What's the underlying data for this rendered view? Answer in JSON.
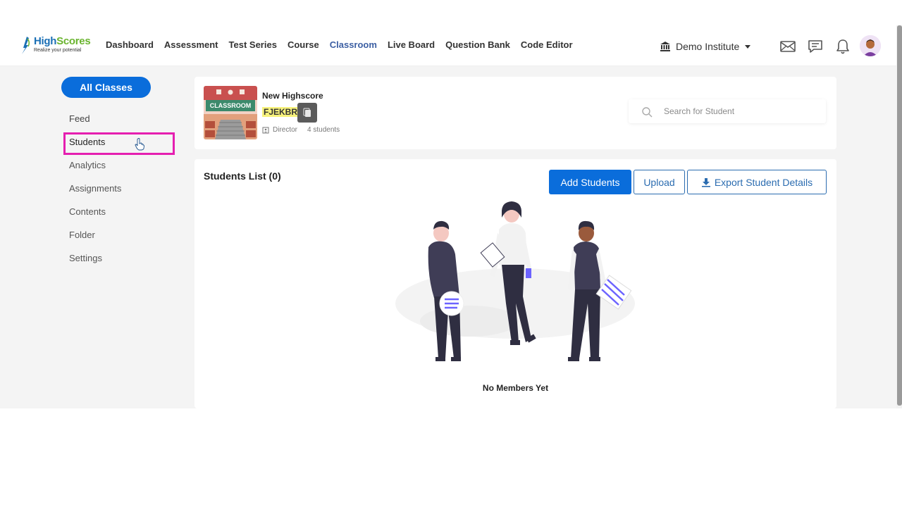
{
  "brand": {
    "name_part1": "High",
    "name_part2": "Scores",
    "tagline": "Realize your potential"
  },
  "nav": {
    "links": [
      "Dashboard",
      "Assessment",
      "Test Series",
      "Course",
      "Classroom",
      "Live Board",
      "Question Bank",
      "Code Editor"
    ],
    "active": "Classroom",
    "institute": "Demo Institute"
  },
  "sidebar": {
    "all_classes": "All Classes",
    "items": [
      "Feed",
      "Students",
      "Analytics",
      "Assignments",
      "Contents",
      "Folder",
      "Settings"
    ],
    "selected": "Students"
  },
  "class_card": {
    "thumb_label": "CLASSROOM",
    "name": "New Highscore",
    "code": "FJEKBR",
    "role": "Director",
    "students": "4 students"
  },
  "search": {
    "placeholder": "Search for Student"
  },
  "students_list": {
    "title": "Students List (0)",
    "add_button": "Add Students",
    "upload_button": "Upload",
    "export_button": "Export Student Details",
    "empty_message": "No Members Yet"
  },
  "colors": {
    "primary": "#0a6ddb",
    "active_nav": "#3c5fa3",
    "highlight": "#e51fb0",
    "code_highlight": "#f7f27c"
  }
}
